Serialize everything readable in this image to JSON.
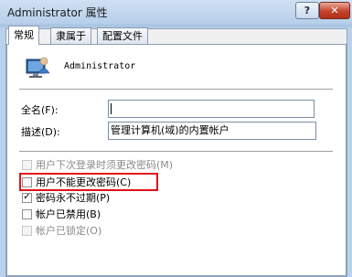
{
  "window": {
    "title": "Administrator 属性",
    "help_label": "?",
    "close_label": "✕"
  },
  "tabs": [
    {
      "label": "常规",
      "active": true
    },
    {
      "label": "隶属于",
      "active": false
    },
    {
      "label": "配置文件",
      "active": false
    }
  ],
  "user": {
    "name": "Administrator"
  },
  "fields": {
    "fullname": {
      "label": "全名(F):",
      "value": ""
    },
    "description": {
      "label": "描述(D):",
      "value": "管理计算机(域)的内置帐户"
    }
  },
  "checkboxes": [
    {
      "label": "用户下次登录时须更改密码(M)",
      "checked": false,
      "disabled": true
    },
    {
      "label": "用户不能更改密码(C)",
      "checked": false,
      "disabled": false,
      "highlighted": true
    },
    {
      "label": "密码永不过期(P)",
      "checked": true,
      "disabled": false
    },
    {
      "label": "帐户已禁用(B)",
      "checked": false,
      "disabled": false
    },
    {
      "label": "帐户已锁定(O)",
      "checked": false,
      "disabled": true
    }
  ],
  "colors": {
    "highlight_border": "#e0101c",
    "title_bar": "#b7cfea"
  }
}
